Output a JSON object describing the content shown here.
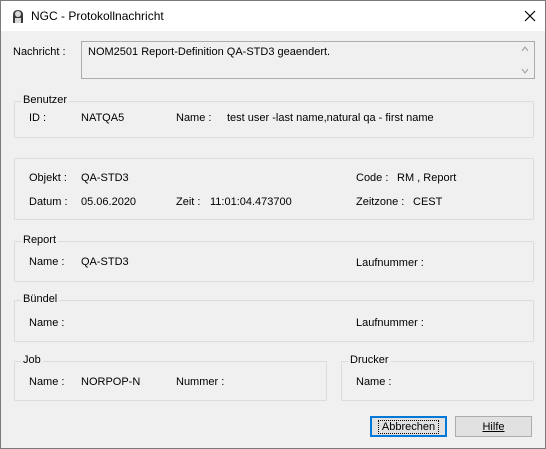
{
  "window": {
    "title": "NGC - Protokollnachricht"
  },
  "message": {
    "label": "Nachricht :",
    "text": "NOM2501 Report-Definition QA-STD3 geaendert."
  },
  "benutzer": {
    "title": "Benutzer",
    "id_label": "ID :",
    "id_value": "NATQA5",
    "name_label": "Name :",
    "name_value": "test user -last name,natural qa - first name"
  },
  "objekt": {
    "objekt_label": "Objekt :",
    "objekt_value": "QA-STD3",
    "code_label": "Code :",
    "code_value": "RM , Report",
    "datum_label": "Datum :",
    "datum_value": "05.06.2020",
    "zeit_label": "Zeit :",
    "zeit_value": "11:01:04.473700",
    "zeitzone_label": "Zeitzone :",
    "zeitzone_value": "CEST"
  },
  "report": {
    "title": "Report",
    "name_label": "Name :",
    "name_value": "QA-STD3",
    "laufnummer_label": "Laufnummer :",
    "laufnummer_value": ""
  },
  "buendel": {
    "title": "Bündel",
    "name_label": "Name :",
    "name_value": "",
    "laufnummer_label": "Laufnummer :",
    "laufnummer_value": ""
  },
  "job": {
    "title": "Job",
    "name_label": "Name :",
    "name_value": "NORPOP-N",
    "nummer_label": "Nummer :",
    "nummer_value": ""
  },
  "drucker": {
    "title": "Drucker",
    "name_label": "Name :",
    "name_value": ""
  },
  "buttons": {
    "abbrechen": "Abbrechen",
    "hilfe": "Hilfe"
  },
  "colors": {
    "dialog_bg": "#f0f0f0",
    "titlebar_bg": "#ffffff",
    "focus_border": "#0078d7",
    "group_border": "#dcdcdc"
  }
}
